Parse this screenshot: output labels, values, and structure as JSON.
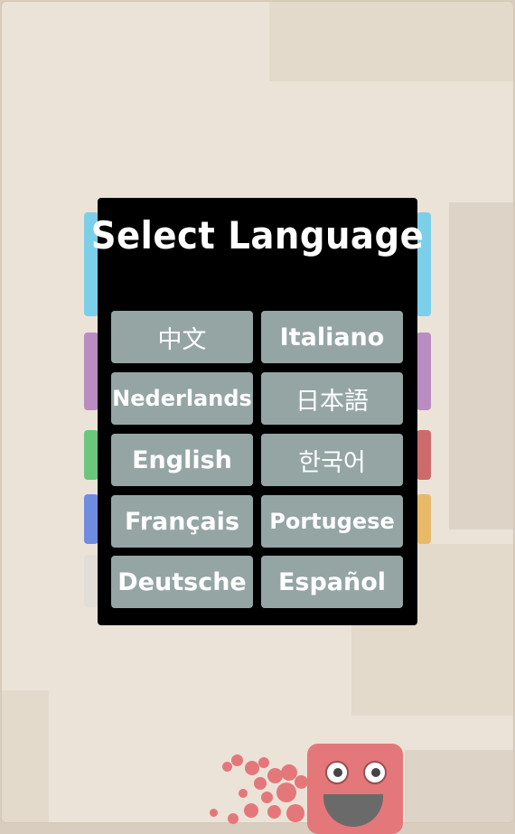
{
  "dialog": {
    "title": "Select Language",
    "languages": [
      "中文",
      "Italiano",
      "Nederlands",
      "日本語",
      "English",
      "한국어",
      "Français",
      "Portugese",
      "Deutsche",
      "Español"
    ]
  },
  "colors": {
    "background": "#ebe3d7",
    "panel": "#000000",
    "button": "#94a5a4",
    "tab_blue": "#7ccfe8",
    "tab_purple": "#b98cc2",
    "tab_green": "#6ac77c",
    "tab_red": "#cc6b6b",
    "tab_indigo": "#6f8de0",
    "tab_orange": "#e9b96a",
    "tab_gray": "#e2ddd6",
    "mascot": "#e4777a"
  },
  "mascot": {
    "icon": "red-block-monster"
  }
}
